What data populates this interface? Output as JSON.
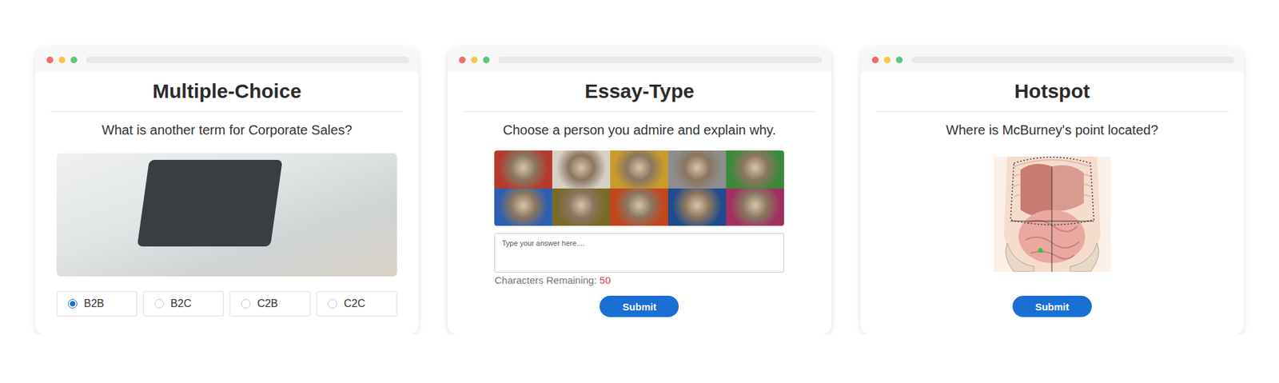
{
  "cards": [
    {
      "kind": "multiple-choice",
      "title": "Multiple-Choice",
      "question": "What is another term for Corporate Sales?",
      "options": [
        {
          "label": "B2B",
          "selected": true
        },
        {
          "label": "B2C",
          "selected": false
        },
        {
          "label": "C2B",
          "selected": false
        },
        {
          "label": "C2C",
          "selected": false
        }
      ]
    },
    {
      "kind": "essay",
      "title": "Essay-Type",
      "question": "Choose a person you admire and explain why.",
      "placeholder": "Type your answer here....",
      "counter_label": "Characters Remaining:",
      "counter_value": "50",
      "button": "Submit"
    },
    {
      "kind": "hotspot",
      "title": "Hotspot",
      "question": "Where is McBurney's point located?",
      "marker_placed": true,
      "button": "Submit"
    }
  ]
}
